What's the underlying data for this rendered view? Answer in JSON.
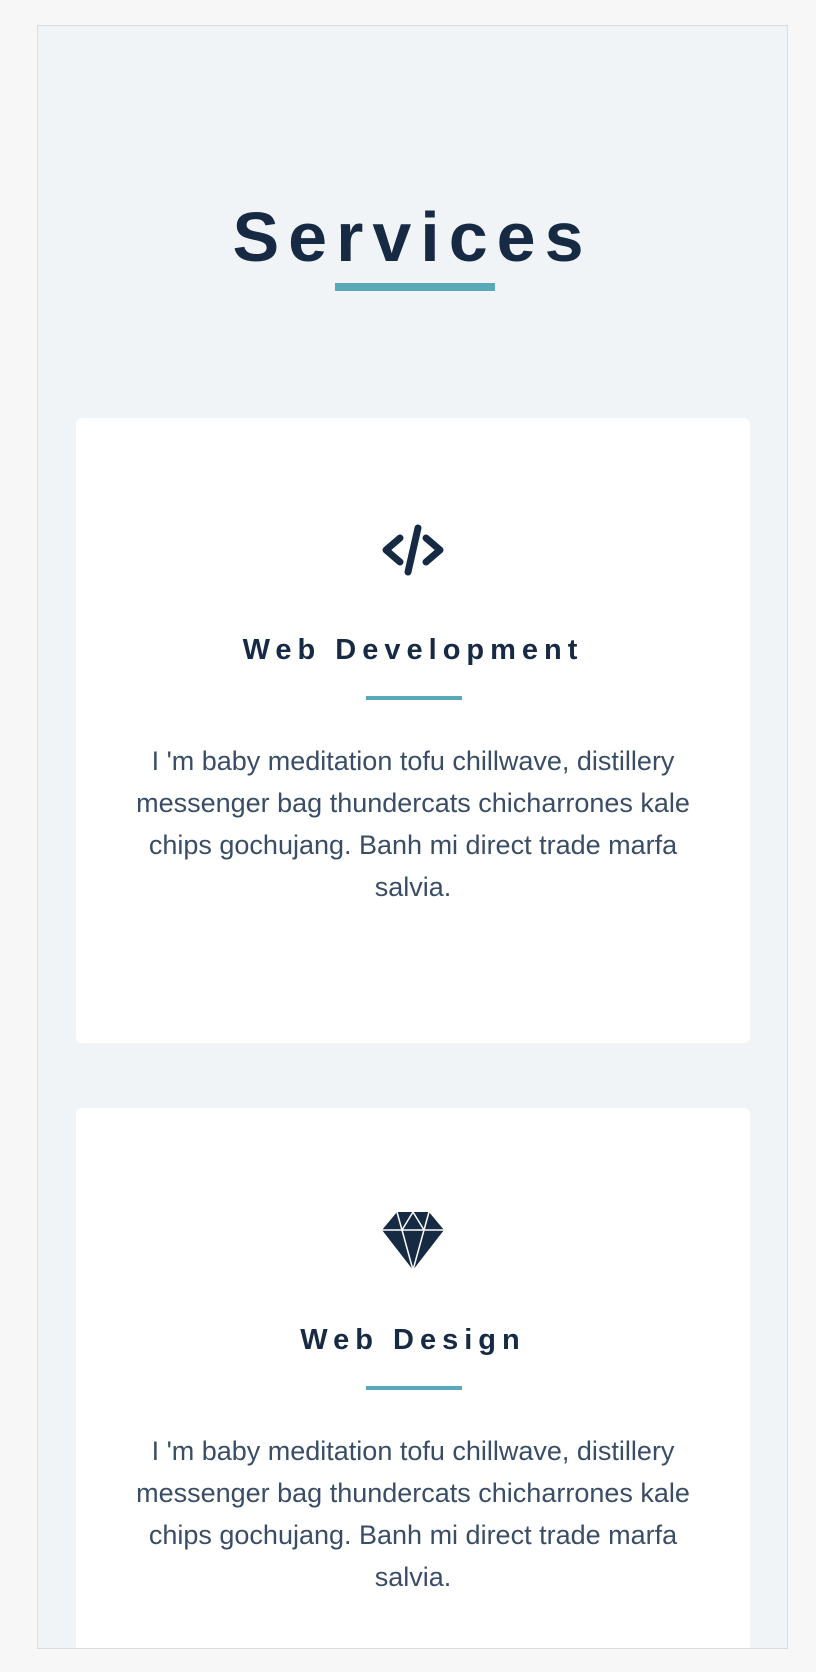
{
  "section": {
    "title": "Services"
  },
  "colors": {
    "heading": "#172a44",
    "accent": "#5aa9b8",
    "body_text": "#3a4d66",
    "page_background": "#f1f4f7",
    "card_background": "#ffffff"
  },
  "services": [
    {
      "icon": "code-icon",
      "title": "Web Development",
      "description": "I 'm baby meditation tofu chillwave, distillery messenger bag thundercats chicharrones kale chips gochujang. Banh mi direct trade marfa salvia."
    },
    {
      "icon": "diamond-icon",
      "title": "Web Design",
      "description": "I 'm baby meditation tofu chillwave, distillery messenger bag thundercats chicharrones kale chips gochujang. Banh mi direct trade marfa salvia."
    }
  ]
}
